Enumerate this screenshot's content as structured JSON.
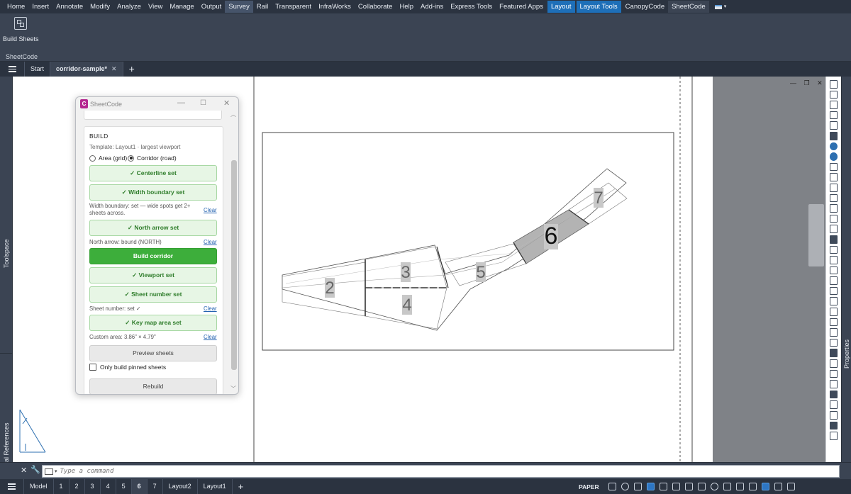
{
  "ribbon": {
    "tabs": [
      "Home",
      "Insert",
      "Annotate",
      "Modify",
      "Analyze",
      "View",
      "Manage",
      "Output",
      "Survey",
      "Rail",
      "Transparent",
      "InfraWorks",
      "Collaborate",
      "Help",
      "Add-ins",
      "Express Tools",
      "Featured Apps",
      "Layout",
      "Layout Tools",
      "CanopyCode",
      "SheetCode"
    ],
    "panel_button_label": "Build Sheets",
    "panel_title": "SheetCode"
  },
  "file_tabs": {
    "start": "Start",
    "document": "corridor-sample*",
    "close_glyph": "✕",
    "new_glyph": "+"
  },
  "side_panels": {
    "toolspace": "Toolspace",
    "external_references": "External References",
    "properties": "Properties"
  },
  "drawing": {
    "window_controls": "— ❐ ✕",
    "sheet_labels": [
      "2",
      "3",
      "4",
      "5",
      "6",
      "7"
    ]
  },
  "palette": {
    "title": "SheetCode",
    "logo_letter": "C",
    "window_buttons": {
      "minimize": "—",
      "maximize": "☐",
      "close": "✕"
    },
    "scroll": {
      "up": "︿",
      "down": "﹀"
    },
    "section_heading": "BUILD",
    "template": "Template: Layout1 · largest viewport",
    "modes": {
      "area": "Area (grid)",
      "corridor": "Corridor (road)",
      "selected": "corridor"
    },
    "buttons": {
      "centerline": "✓ Centerline set",
      "width_boundary": "✓ Width boundary set",
      "north_arrow": "✓ North arrow set",
      "build_corridor": "Build corridor",
      "viewport": "✓ Viewport set",
      "sheet_number": "✓ Sheet number set",
      "key_map": "✓ Key map area set",
      "preview": "Preview sheets",
      "rebuild": "Rebuild"
    },
    "info": {
      "width_boundary": "Width boundary: set — wide spots get 2+ sheets across.",
      "north_arrow": "North arrow: bound (NORTH)",
      "sheet_number": "Sheet number: set ✓",
      "custom_area": "Custom area: 3.86\" × 4.79\""
    },
    "clear_label": "Clear",
    "pinned_only": {
      "label": "Only build pinned sheets",
      "checked": false
    }
  },
  "command_line": {
    "placeholder": "Type a command",
    "close_glyph": "✕",
    "wrench_glyph": "🔧",
    "caret_glyph": "▾"
  },
  "status_bar": {
    "layout_tabs": [
      "Model",
      "1",
      "2",
      "3",
      "4",
      "5",
      "6",
      "7",
      "Layout2",
      "Layout1"
    ],
    "active_tab": "6",
    "add_glyph": "+",
    "space": "PAPER"
  }
}
